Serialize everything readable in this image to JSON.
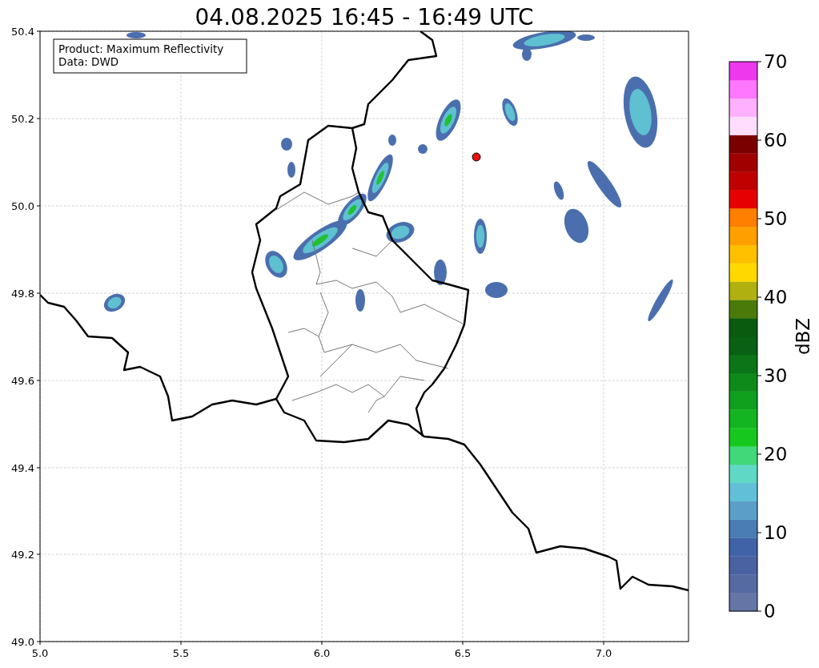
{
  "title": "04.08.2025 16:45 - 16:49 UTC",
  "annotation": [
    "Product: Maximum Reflectivity",
    "Data: DWD"
  ],
  "x_ticks": [
    "5.0",
    "5.5",
    "6.0",
    "6.5",
    "7.0"
  ],
  "y_ticks": [
    "50.4",
    "50.2",
    "50.0",
    "49.8",
    "49.6",
    "49.4",
    "49.2",
    "49.0"
  ],
  "colorbar": {
    "label": "dBZ",
    "ticks": [
      "70",
      "60",
      "50",
      "40",
      "30",
      "20",
      "10",
      "0"
    ],
    "segments": [
      {
        "color": "#6475a6"
      },
      {
        "color": "#566aa2"
      },
      {
        "color": "#4a62a2"
      },
      {
        "color": "#4062a6"
      },
      {
        "color": "#4a7db3"
      },
      {
        "color": "#5b9fc8"
      },
      {
        "color": "#62bfd8"
      },
      {
        "color": "#60d8c6"
      },
      {
        "color": "#40d878"
      },
      {
        "color": "#16c81e"
      },
      {
        "color": "#13b520"
      },
      {
        "color": "#10a01e"
      },
      {
        "color": "#0e8a1a"
      },
      {
        "color": "#0c7518"
      },
      {
        "color": "#0a6014"
      },
      {
        "color": "#0a5a10"
      },
      {
        "color": "#4a7a0a"
      },
      {
        "color": "#b0b010"
      },
      {
        "color": "#ffd800"
      },
      {
        "color": "#ffc000"
      },
      {
        "color": "#ff9f00"
      },
      {
        "color": "#ff7f00"
      },
      {
        "color": "#e60000"
      },
      {
        "color": "#c00000"
      },
      {
        "color": "#a00000"
      },
      {
        "color": "#7a0000"
      },
      {
        "color": "#ffddff"
      },
      {
        "color": "#ffb0ff"
      },
      {
        "color": "#ff77ff"
      },
      {
        "color": "#ee38ee"
      }
    ]
  }
}
